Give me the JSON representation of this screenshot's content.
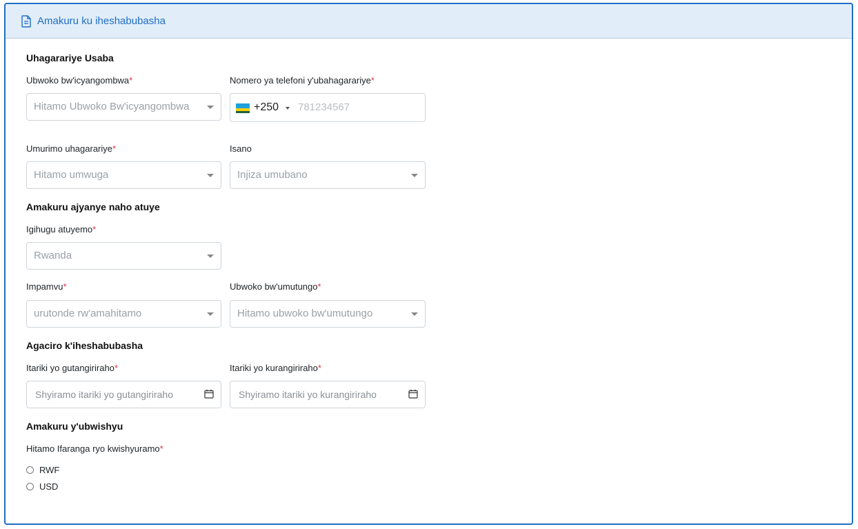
{
  "header": {
    "title": "Amakuru ku iheshabubasha",
    "icon": "document-icon"
  },
  "sections": {
    "representative": "Uhagarariye Usaba",
    "location": "Amakuru ajyanye naho atuye",
    "validity": "Agaciro k'iheshabubasha",
    "payment": "Amakuru y'ubwishyu"
  },
  "fields": {
    "id_type": {
      "label": "Ubwoko bw'icyangombwa",
      "placeholder": "Hitamo Ubwoko Bw'icyangombwa"
    },
    "phone": {
      "label": "Nomero ya telefoni y'ubahagarariye",
      "code": "+250",
      "placeholder": "781234567"
    },
    "occupation": {
      "label": "Umurimo uhagarariye",
      "placeholder": "Hitamo umwuga"
    },
    "relation": {
      "label": "Isano",
      "placeholder": "Injiza umubano"
    },
    "country": {
      "label": "Igihugu atuyemo",
      "value": "Rwanda"
    },
    "reason": {
      "label": "Impamvu",
      "placeholder": "urutonde rw'amahitamo"
    },
    "relationship_type": {
      "label": "Ubwoko bw'umutungo",
      "placeholder": "Hitamo ubwoko bw'umutungo"
    },
    "start_date": {
      "label": "Itariki yo gutangiriraho",
      "placeholder": "Shyiramo itariki yo gutangiriraho"
    },
    "end_date": {
      "label": "Itariki yo kurangiriraho",
      "placeholder": "Shyiramo itariki yo kurangiriraho"
    },
    "currency": {
      "label": "Hitamo Ifaranga ryo kwishyuramo",
      "options": [
        "RWF",
        "USD"
      ]
    }
  },
  "required_marker": "*",
  "colors": {
    "accent": "#1f6ec4",
    "header_bg": "#e1edf8",
    "required": "#dc3545"
  }
}
